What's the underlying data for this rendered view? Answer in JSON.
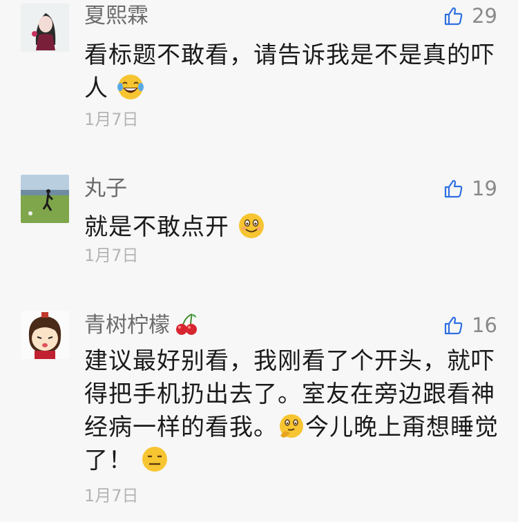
{
  "comments": [
    {
      "username": "夏熙霖",
      "likes": "29",
      "text_line1": "看标题不敢看，请告诉我是不是真的吓",
      "text_line2": "人",
      "date": "1月7日",
      "emoji": "laughing-tears-emoji"
    },
    {
      "username": "丸子",
      "likes": "19",
      "text_line1": "就是不敢点开",
      "date": "1月7日",
      "emoji": "smiling-emoji"
    },
    {
      "username": "青树柠檬",
      "likes": "16",
      "text_line1": "建议最好别看，我刚看了个开头，就吓",
      "text_line2": "得把手机扔出去了。室友在旁边跟看神",
      "text_line3a": "经病一样的看我。",
      "text_line3b": "今儿晚上甭想睡觉",
      "text_line4": "了！",
      "date": "1月7日",
      "emoji": "thinking-emoji"
    }
  ],
  "colors": {
    "background": "#f7f7f7",
    "username": "#6b6b6b",
    "text": "#1a1a1a",
    "date": "#b4b4b4",
    "like_icon": "#2d6fe0"
  },
  "icons": [
    "thumb-up-icon",
    "cherry-icon"
  ]
}
